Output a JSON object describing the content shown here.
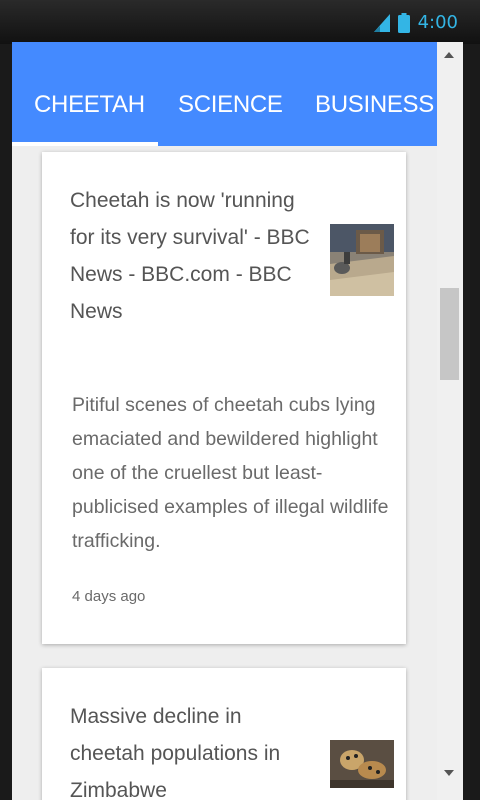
{
  "status_bar": {
    "time": "4:00",
    "signal_icon": "signal-icon",
    "battery_icon": "battery-icon",
    "accent_color": "#33b5e5"
  },
  "tabs": [
    {
      "label": "CHEETAH",
      "selected": true
    },
    {
      "label": "SCIENCE",
      "selected": false
    },
    {
      "label": "BUSINESS",
      "selected": false
    }
  ],
  "colors": {
    "tab_bar": "#448aff",
    "background": "#eeeeee",
    "card": "#ffffff"
  },
  "articles": [
    {
      "title": "Cheetah is now 'running for its very survival' - BBC News - BBC.com - BBC News",
      "description": "Pitiful scenes of cheetah cubs lying emaciated and bewildered highlight one of the cruellest but least-publicised examples of illegal wildlife trafficking.",
      "time": "4 days ago"
    },
    {
      "title": "Massive decline in cheetah populations in Zimbabwe",
      "description": "",
      "time": ""
    }
  ]
}
